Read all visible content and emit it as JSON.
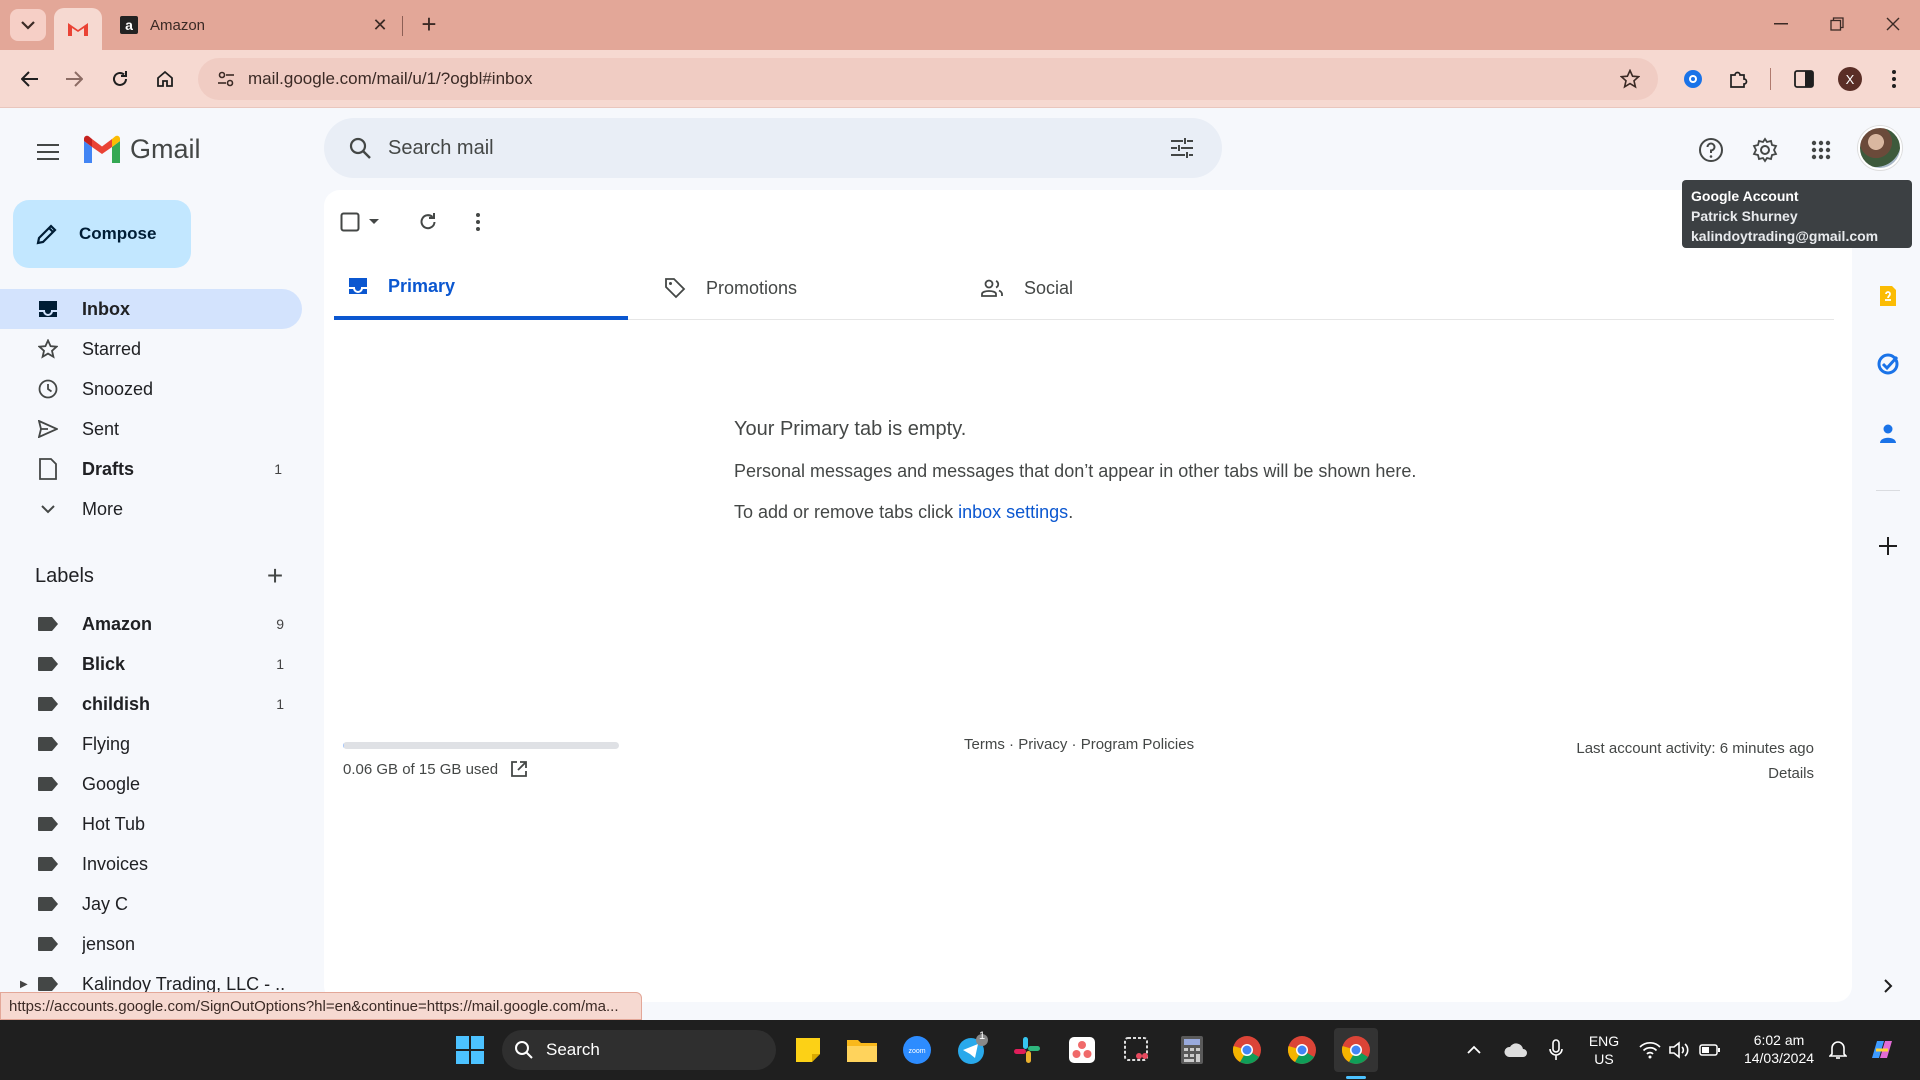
{
  "browser": {
    "inactive_tab_title": "Amazon",
    "url": "mail.google.com/mail/u/1/?ogbl#inbox",
    "profile_initial": "X",
    "status_link": "https://accounts.google.com/SignOutOptions?hl=en&continue=https://mail.google.com/ma..."
  },
  "gmail": {
    "logo_text": "Gmail",
    "search_placeholder": "Search mail",
    "compose_label": "Compose",
    "tooltip": {
      "title": "Google Account",
      "name": "Patrick Shurney",
      "email": "kalindoytrading@gmail.com"
    },
    "nav": [
      {
        "label": "Inbox",
        "icon": "inbox-icon",
        "active": true,
        "bold": true,
        "count": ""
      },
      {
        "label": "Starred",
        "icon": "star-icon",
        "active": false,
        "bold": false,
        "count": ""
      },
      {
        "label": "Snoozed",
        "icon": "clock-icon",
        "active": false,
        "bold": false,
        "count": ""
      },
      {
        "label": "Sent",
        "icon": "send-icon",
        "active": false,
        "bold": false,
        "count": ""
      },
      {
        "label": "Drafts",
        "icon": "draft-icon",
        "active": false,
        "bold": true,
        "count": "1"
      },
      {
        "label": "More",
        "icon": "chevron-down-icon",
        "active": false,
        "bold": false,
        "count": ""
      }
    ],
    "labels_title": "Labels",
    "labels": [
      {
        "label": "Amazon",
        "bold": true,
        "count": "9"
      },
      {
        "label": "Blick",
        "bold": true,
        "count": "1"
      },
      {
        "label": "childish",
        "bold": true,
        "count": "1"
      },
      {
        "label": "Flying",
        "bold": false,
        "count": ""
      },
      {
        "label": "Google",
        "bold": false,
        "count": ""
      },
      {
        "label": "Hot Tub",
        "bold": false,
        "count": ""
      },
      {
        "label": "Invoices",
        "bold": false,
        "count": ""
      },
      {
        "label": "Jay C",
        "bold": false,
        "count": ""
      },
      {
        "label": "jenson",
        "bold": false,
        "count": ""
      },
      {
        "label": "Kalindoy Trading, LLC - ...",
        "bold": false,
        "count": ""
      }
    ],
    "tabs": [
      {
        "label": "Primary",
        "icon": "inbox-tab-icon",
        "active": true
      },
      {
        "label": "Promotions",
        "icon": "tag-icon",
        "active": false
      },
      {
        "label": "Social",
        "icon": "people-icon",
        "active": false
      }
    ],
    "empty": {
      "title": "Your Primary tab is empty.",
      "description": "Personal messages and messages that don’t appear in other tabs will be shown here.",
      "settings_prefix": "To add or remove tabs click ",
      "settings_link": "inbox settings",
      "settings_suffix": "."
    },
    "storage": {
      "text": "0.06 GB of 15 GB used",
      "used_fraction": 0.004
    },
    "footer": {
      "terms": "Terms",
      "privacy": "Privacy",
      "policies": "Program Policies",
      "sep": " · "
    },
    "activity": {
      "text": "Last account activity: 6 minutes ago",
      "details": "Details"
    }
  },
  "taskbar": {
    "search_label": "Search",
    "language": "ENG",
    "region": "US",
    "time": "6:02 am",
    "date": "14/03/2024",
    "telegram_badge": "1"
  },
  "colors": {
    "accent": "#0b57d0",
    "compose_bg": "#c2e7ff",
    "active_nav": "#d3e3fd",
    "chrome_tabstrip": "#e3a798"
  }
}
